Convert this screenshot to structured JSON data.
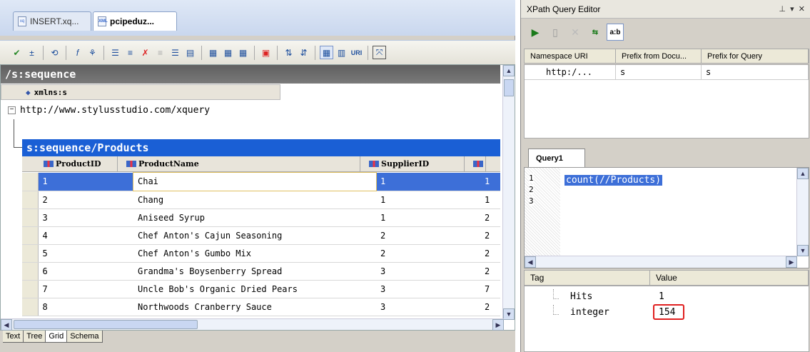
{
  "document_tabs": [
    {
      "label": "INSERT.xq..."
    },
    {
      "label": "pcipeduz..."
    }
  ],
  "grid": {
    "root_header": "/s:sequence",
    "attribute_name": "xmlns:s",
    "attribute_value": "http://www.stylusstudio.com/xquery",
    "table_header": "s:sequence/Products",
    "columns": [
      "ProductID",
      "ProductName",
      "SupplierID"
    ],
    "rows": [
      {
        "id": "1",
        "name": "Chai",
        "supplier": "1",
        "extra": "1"
      },
      {
        "id": "2",
        "name": "Chang",
        "supplier": "1",
        "extra": "1"
      },
      {
        "id": "3",
        "name": "Aniseed Syrup",
        "supplier": "1",
        "extra": "2"
      },
      {
        "id": "4",
        "name": "Chef Anton's Cajun Seasoning",
        "supplier": "2",
        "extra": "2"
      },
      {
        "id": "5",
        "name": "Chef Anton's Gumbo Mix",
        "supplier": "2",
        "extra": "2"
      },
      {
        "id": "6",
        "name": "Grandma's Boysenberry Spread",
        "supplier": "3",
        "extra": "2"
      },
      {
        "id": "7",
        "name": "Uncle Bob's Organic Dried Pears",
        "supplier": "3",
        "extra": "7"
      },
      {
        "id": "8",
        "name": "Northwoods Cranberry Sauce",
        "supplier": "3",
        "extra": "2"
      }
    ]
  },
  "view_tabs": [
    "Text",
    "Tree",
    "Grid",
    "Schema"
  ],
  "active_view_tab": "Grid",
  "xpath": {
    "title": "XPath Query Editor",
    "toolbar_label": "a:b",
    "ns_columns": [
      "Namespace URI",
      "Prefix from Docu...",
      "Prefix for Query"
    ],
    "ns_row": {
      "uri": "http:/...",
      "doc_prefix": "s",
      "query_prefix": "s"
    },
    "query_tab": "Query1",
    "line_numbers": [
      "1",
      "2",
      "3"
    ],
    "query": "count(//Products)",
    "result_columns": [
      "Tag",
      "Value"
    ],
    "results": [
      {
        "tag": "Hits",
        "value": "1"
      },
      {
        "tag": "integer",
        "value": "154"
      }
    ]
  },
  "icons": {
    "run": "play-icon",
    "new": "new-document-icon",
    "delete": "delete-icon",
    "xml": "xml-icon"
  }
}
